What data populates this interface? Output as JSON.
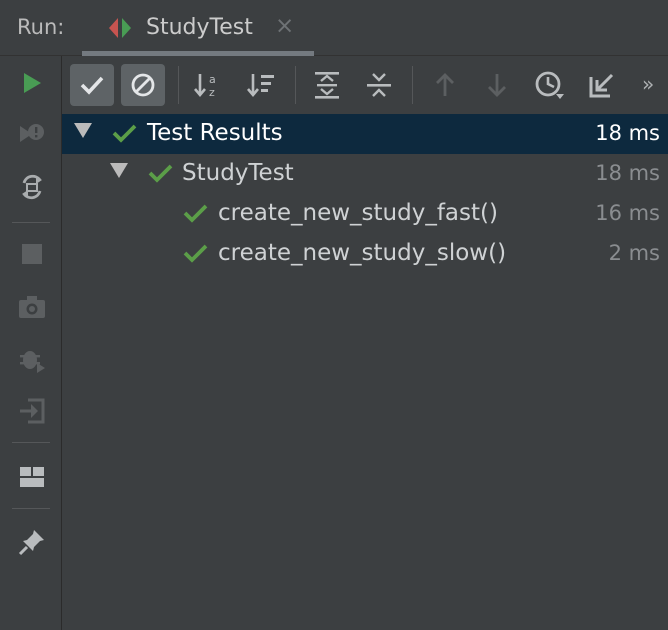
{
  "header": {
    "run_label": "Run:",
    "tab_title": "StudyTest",
    "tab_close": "×"
  },
  "toolbar": {
    "more": "»",
    "buttons": [
      {
        "name": "show-passed",
        "icon": "check-icon",
        "toggled": true
      },
      {
        "name": "show-ignored",
        "icon": "ignored-icon",
        "toggled": true
      },
      {
        "name": "sort-alpha",
        "icon": "sort-alpha-icon"
      },
      {
        "name": "sort-duration",
        "icon": "sort-duration-icon"
      },
      {
        "name": "expand-all",
        "icon": "expand-all-icon"
      },
      {
        "name": "collapse-all",
        "icon": "collapse-all-icon"
      },
      {
        "name": "prev-failed",
        "icon": "arrow-up-icon"
      },
      {
        "name": "next-failed",
        "icon": "arrow-down-icon"
      },
      {
        "name": "history",
        "icon": "clock-icon"
      },
      {
        "name": "import",
        "icon": "import-icon"
      }
    ]
  },
  "tree": {
    "rows": [
      {
        "label": "Test Results",
        "duration": "18 ms",
        "selected": true
      },
      {
        "label": "StudyTest",
        "duration": "18 ms"
      },
      {
        "label": "create_new_study_fast()",
        "duration": "16 ms"
      },
      {
        "label": "create_new_study_slow()",
        "duration": "2 ms"
      }
    ]
  },
  "colors": {
    "background": "#3c3f41",
    "selection": "#0d293e",
    "pass_green": "#5b9e48",
    "run_green": "#499c54"
  }
}
